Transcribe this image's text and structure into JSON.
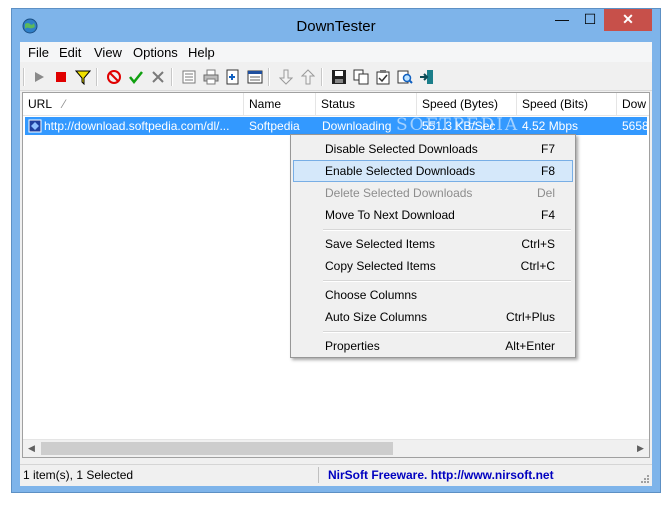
{
  "window": {
    "title": "DownTester",
    "min_glyph": "—",
    "max_glyph": "☐",
    "close_glyph": "✕"
  },
  "menu": [
    "File",
    "Edit",
    "View",
    "Options",
    "Help"
  ],
  "toolbar": [
    "play-icon",
    "stop-icon",
    "filter-icon",
    "cancel-icon",
    "check-icon",
    "delete-icon",
    "properties-icon",
    "print-icon",
    "add-icon",
    "html-report-icon",
    "move-down-icon",
    "move-up-icon",
    "save-icon",
    "copy-icon",
    "options-icon",
    "find-icon",
    "exit-icon"
  ],
  "list": {
    "columns": [
      "URL",
      "Name",
      "Status",
      "Speed (Bytes)",
      "Speed (Bits)",
      "Dow"
    ],
    "sort_indicator": "⁄",
    "rows": [
      {
        "url": "http://download.softpedia.com/dl/...",
        "name": "Softpedia",
        "status": "Downloading",
        "speed_bytes": "551.3 KB/Sec",
        "speed_bits": "4.52 Mbps",
        "downloaded": "5658"
      }
    ]
  },
  "context_menu": {
    "items": [
      {
        "label": "Disable Selected Downloads",
        "key": "F7"
      },
      {
        "label": "Enable Selected Downloads",
        "key": "F8",
        "highlighted": true
      },
      {
        "label": "Delete Selected Downloads",
        "key": "Del",
        "disabled": true
      },
      {
        "label": "Move To Next Download",
        "key": "F4"
      },
      {
        "label": "Save Selected Items",
        "key": "Ctrl+S"
      },
      {
        "label": "Copy Selected Items",
        "key": "Ctrl+C"
      },
      {
        "label": "Choose Columns",
        "key": ""
      },
      {
        "label": "Auto Size Columns",
        "key": "Ctrl+Plus"
      },
      {
        "label": "Properties",
        "key": "Alt+Enter"
      }
    ]
  },
  "status": {
    "left": "1 item(s), 1 Selected",
    "right": "NirSoft Freeware.  http://www.nirsoft.net"
  },
  "scroll": {
    "left_arrow": "◀",
    "right_arrow": "▶"
  },
  "watermark": "SOFTPEDIA",
  "colors": {
    "title_bar": "#7eb4ea",
    "selection": "#3399ff",
    "close_button": "#c7504a",
    "link": "#0000c0"
  }
}
